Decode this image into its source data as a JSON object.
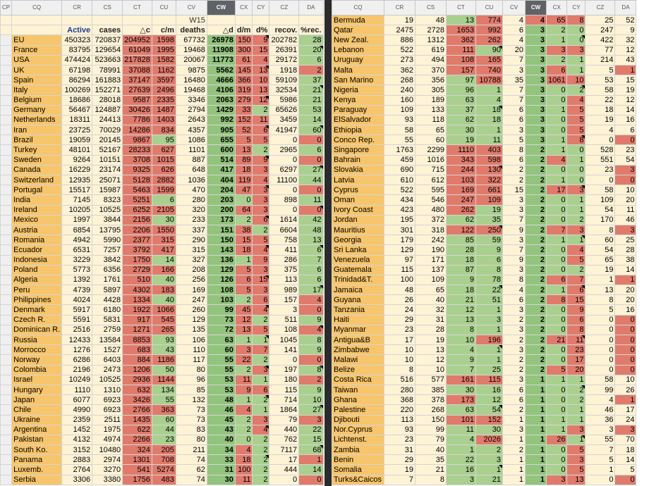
{
  "left": {
    "col_letters": [
      "CP",
      "CQ",
      "CR",
      "CS",
      "CT",
      "CU",
      "CV",
      "CW",
      "CX",
      "CY",
      "CZ",
      "DA"
    ],
    "header_top": [
      "",
      "",
      "",
      "",
      "",
      "",
      "W15",
      "",
      "",
      "",
      "",
      ""
    ],
    "header_bottom": [
      "",
      "",
      "Active",
      "cases",
      "△c",
      "c/m",
      "deaths",
      "△d",
      "d/m",
      "d%",
      "recov.",
      "%rec."
    ],
    "rows": [
      [
        "EU",
        "450323",
        "720837",
        "204952",
        "1598",
        "67732",
        "26978",
        "150",
        "9",
        "202782",
        "28"
      ],
      [
        "France",
        "83795",
        "129654",
        "61049",
        "1995",
        "19468",
        "11908",
        "300",
        "15",
        "26391",
        "20"
      ],
      [
        "USA",
        "474424",
        "523663",
        "217828",
        "1582",
        "20067",
        "11773",
        "61",
        "4",
        "29172",
        "6"
      ],
      [
        "UK",
        "67198",
        "78991",
        "37088",
        "1162",
        "9875",
        "5562",
        "145",
        "13",
        "1918",
        "2"
      ],
      [
        "Spain",
        "86294",
        "161883",
        "37147",
        "3597",
        "16480",
        "4666",
        "366",
        "10",
        "59109",
        "37"
      ],
      [
        "Italy",
        "100269",
        "152271",
        "27639",
        "2496",
        "19468",
        "4106",
        "319",
        "13",
        "32534",
        "21"
      ],
      [
        "Belgium",
        "18686",
        "28018",
        "9587",
        "2335",
        "3346",
        "2063",
        "279",
        "12",
        "5986",
        "21"
      ],
      [
        "Germany",
        "56467",
        "124887",
        "30426",
        "1487",
        "2794",
        "1429",
        "33",
        "2",
        "65626",
        "53"
      ],
      [
        "Netherlands",
        "18311",
        "24413",
        "7786",
        "1403",
        "2643",
        "992",
        "152",
        "11",
        "3459",
        "14"
      ],
      [
        "Iran",
        "23725",
        "70029",
        "14286",
        "834",
        "4357",
        "905",
        "52",
        "6",
        "41947",
        "60"
      ],
      [
        "Brazil",
        "19059",
        "20145",
        "9867",
        "95",
        "1086",
        "655",
        "5",
        "5",
        "0",
        "0"
      ],
      [
        "Turkey",
        "48101",
        "52167",
        "28233",
        "627",
        "1101",
        "600",
        "13",
        "2",
        "2965",
        "6"
      ],
      [
        "Sweden",
        "9264",
        "10151",
        "3708",
        "1015",
        "887",
        "514",
        "89",
        "9",
        "0",
        "0"
      ],
      [
        "Canada",
        "16229",
        "23174",
        "9325",
        "626",
        "648",
        "417",
        "18",
        "3",
        "6297",
        "27"
      ],
      [
        "Switzerland",
        "12935",
        "25071",
        "5128",
        "2882",
        "1036",
        "404",
        "119",
        "4",
        "11100",
        "44"
      ],
      [
        "Portugal",
        "15517",
        "15987",
        "5463",
        "1599",
        "470",
        "204",
        "47",
        "3",
        "0",
        "0"
      ],
      [
        "India",
        "7145",
        "8323",
        "5251",
        "6",
        "280",
        "203",
        "0",
        "3",
        "898",
        "11"
      ],
      [
        "Ireland",
        "10205",
        "10525",
        "6252",
        "2105",
        "320",
        "200",
        "64",
        "3",
        "0",
        "0"
      ],
      [
        "Mexico",
        "1997",
        "3844",
        "2156",
        "30",
        "233",
        "173",
        "2",
        "6",
        "1614",
        "42"
      ],
      [
        "Austria",
        "6854",
        "13795",
        "2206",
        "1550",
        "337",
        "151",
        "38",
        "2",
        "6604",
        "48"
      ],
      [
        "Romania",
        "4942",
        "5990",
        "2377",
        "315",
        "290",
        "150",
        "15",
        "5",
        "758",
        "13"
      ],
      [
        "Ecuador",
        "6531",
        "7257",
        "3792",
        "417",
        "315",
        "143",
        "18",
        "4",
        "411",
        "6"
      ],
      [
        "Indonesia",
        "3229",
        "3842",
        "1750",
        "14",
        "327",
        "136",
        "1",
        "9",
        "286",
        "7"
      ],
      [
        "Poland",
        "5773",
        "6356",
        "2729",
        "166",
        "208",
        "129",
        "5",
        "3",
        "375",
        "6"
      ],
      [
        "Algeria",
        "1392",
        "1761",
        "510",
        "40",
        "256",
        "126",
        "6",
        "15",
        "113",
        "6"
      ],
      [
        "Peru",
        "4739",
        "5897",
        "4302",
        "183",
        "169",
        "108",
        "5",
        "3",
        "989",
        "17"
      ],
      [
        "Philippines",
        "4024",
        "4428",
        "1334",
        "40",
        "247",
        "103",
        "2",
        "6",
        "157",
        "4"
      ],
      [
        "Denmark",
        "5917",
        "6180",
        "1922",
        "1066",
        "260",
        "99",
        "45",
        "4",
        "3",
        "0"
      ],
      [
        "Czech R.",
        "5591",
        "5831",
        "917",
        "545",
        "129",
        "73",
        "12",
        "2",
        "511",
        "9"
      ],
      [
        "Dominican R.",
        "2516",
        "2759",
        "1271",
        "265",
        "135",
        "72",
        "13",
        "5",
        "108",
        "4"
      ],
      [
        "Russia",
        "12433",
        "13584",
        "8853",
        "93",
        "106",
        "63",
        "1",
        "1",
        "1045",
        "8"
      ],
      [
        "Morrocco",
        "1276",
        "1527",
        "683",
        "43",
        "110",
        "60",
        "3",
        "7",
        "141",
        "9"
      ],
      [
        "Norway",
        "6286",
        "6403",
        "884",
        "1186",
        "117",
        "55",
        "22",
        "2",
        "0",
        "0"
      ],
      [
        "Colombia",
        "2196",
        "2473",
        "1206",
        "50",
        "80",
        "55",
        "2",
        "3",
        "197",
        "8"
      ],
      [
        "Israel",
        "10249",
        "10525",
        "2936",
        "1144",
        "96",
        "53",
        "11",
        "1",
        "180",
        "2"
      ],
      [
        "Hungary",
        "1110",
        "1310",
        "632",
        "134",
        "85",
        "53",
        "9",
        "6",
        "115",
        "9"
      ],
      [
        "Japan",
        "6077",
        "6923",
        "3426",
        "55",
        "132",
        "48",
        "1",
        "2",
        "714",
        "10"
      ],
      [
        "Chile",
        "4990",
        "6923",
        "2766",
        "363",
        "73",
        "46",
        "4",
        "1",
        "1864",
        "27"
      ],
      [
        "Ukraine",
        "2359",
        "2511",
        "1435",
        "60",
        "73",
        "45",
        "2",
        "3",
        "79",
        "3"
      ],
      [
        "Argentina",
        "1452",
        "1975",
        "622",
        "44",
        "83",
        "43",
        "2",
        "4",
        "440",
        "22"
      ],
      [
        "Pakistan",
        "4132",
        "4974",
        "2266",
        "23",
        "80",
        "40",
        "0",
        "2",
        "762",
        "15"
      ],
      [
        "South Ko.",
        "3152",
        "10480",
        "324",
        "205",
        "211",
        "34",
        "4",
        "2",
        "7117",
        "68"
      ],
      [
        "Panama",
        "2883",
        "2974",
        "1301",
        "708",
        "74",
        "33",
        "18",
        "2",
        "17",
        "1"
      ],
      [
        "Luxemb.",
        "2764",
        "3270",
        "541",
        "5274",
        "62",
        "31",
        "100",
        "2",
        "444",
        "14"
      ],
      [
        "Serbia",
        "3306",
        "3380",
        "1756",
        "483",
        "74",
        "30",
        "11",
        "2",
        "0",
        "0"
      ]
    ]
  },
  "right": {
    "col_letters": [
      "CQ",
      "CR",
      "CS",
      "CT",
      "CU",
      "CV",
      "CW",
      "CX",
      "CY",
      "CZ",
      "DA"
    ],
    "rows": [
      [
        "Bermuda",
        "19",
        "48",
        "13",
        "774",
        "4",
        "4",
        "65",
        "8",
        "25",
        "52"
      ],
      [
        "Qatar",
        "2475",
        "2728",
        "1653",
        "992",
        "6",
        "3",
        "2",
        "0",
        "247",
        "9"
      ],
      [
        "New Zeal.",
        "886",
        "1312",
        "362",
        "262",
        "4",
        "3",
        "1",
        "0",
        "422",
        "32"
      ],
      [
        "Lebanon",
        "522",
        "619",
        "111",
        "90",
        "20",
        "3",
        "3",
        "3",
        "77",
        "12"
      ],
      [
        "Uruguay",
        "273",
        "494",
        "108",
        "165",
        "7",
        "3",
        "2",
        "1",
        "214",
        "43"
      ],
      [
        "Malta",
        "362",
        "370",
        "157",
        "740",
        "3",
        "3",
        "6",
        "1",
        "5",
        "1"
      ],
      [
        "San Marino",
        "268",
        "356",
        "97",
        "10788",
        "35",
        "3",
        "1061",
        "10",
        "53",
        "15"
      ],
      [
        "Nigeria",
        "240",
        "305",
        "96",
        "1",
        "7",
        "3",
        "0",
        "2",
        "58",
        "19"
      ],
      [
        "Kenya",
        "160",
        "189",
        "63",
        "4",
        "7",
        "3",
        "0",
        "4",
        "22",
        "12"
      ],
      [
        "Paraguay",
        "109",
        "133",
        "37",
        "18",
        "6",
        "3",
        "1",
        "5",
        "18",
        "14"
      ],
      [
        "ElSalvador",
        "93",
        "118",
        "62",
        "18",
        "6",
        "3",
        "0",
        "5",
        "19",
        "16"
      ],
      [
        "Ethiopia",
        "58",
        "65",
        "30",
        "1",
        "3",
        "3",
        "0",
        "5",
        "4",
        "6"
      ],
      [
        "Conco Rep.",
        "55",
        "60",
        "19",
        "11",
        "5",
        "3",
        "1",
        "8",
        "0",
        "0"
      ],
      [
        "Singapore",
        "1763",
        "2299",
        "1110",
        "403",
        "8",
        "2",
        "1",
        "0",
        "528",
        "23"
      ],
      [
        "Bahrain",
        "459",
        "1016",
        "343",
        "598",
        "6",
        "2",
        "4",
        "1",
        "551",
        "54"
      ],
      [
        "Slovakia",
        "690",
        "715",
        "244",
        "130",
        "2",
        "2",
        "0",
        "0",
        "23",
        "3"
      ],
      [
        "Latvia",
        "610",
        "612",
        "103",
        "322",
        "2",
        "2",
        "1",
        "0",
        "0",
        "0"
      ],
      [
        "Cyprus",
        "522",
        "595",
        "169",
        "661",
        "15",
        "2",
        "17",
        "3",
        "58",
        "10"
      ],
      [
        "Oman",
        "434",
        "546",
        "247",
        "109",
        "3",
        "2",
        "0",
        "1",
        "109",
        "20"
      ],
      [
        "Ivory Coast",
        "423",
        "480",
        "262",
        "19",
        "3",
        "2",
        "0",
        "1",
        "54",
        "11"
      ],
      [
        "Jordan",
        "195",
        "372",
        "62",
        "35",
        "7",
        "2",
        "0",
        "2",
        "170",
        "46"
      ],
      [
        "Mauritius",
        "301",
        "318",
        "122",
        "250",
        "9",
        "2",
        "7",
        "3",
        "8",
        "3"
      ],
      [
        "Georgia",
        "179",
        "242",
        "85",
        "59",
        "3",
        "2",
        "1",
        "1",
        "60",
        "25"
      ],
      [
        "Sri Lanka",
        "129",
        "190",
        "28",
        "9",
        "7",
        "2",
        "0",
        "4",
        "54",
        "28"
      ],
      [
        "Venezuela",
        "97",
        "171",
        "18",
        "6",
        "9",
        "2",
        "0",
        "5",
        "65",
        "38"
      ],
      [
        "Guatemala",
        "115",
        "137",
        "87",
        "8",
        "3",
        "2",
        "0",
        "2",
        "19",
        "14"
      ],
      [
        "Trinidad&T.",
        "100",
        "109",
        "9",
        "78",
        "8",
        "2",
        "6",
        "7",
        "1",
        "1"
      ],
      [
        "Jamaica",
        "48",
        "65",
        "18",
        "22",
        "4",
        "2",
        "1",
        "6",
        "13",
        "20"
      ],
      [
        "Guyana",
        "26",
        "40",
        "21",
        "51",
        "6",
        "2",
        "8",
        "15",
        "8",
        "20"
      ],
      [
        "Tanzania",
        "24",
        "32",
        "12",
        "1",
        "3",
        "2",
        "0",
        "9",
        "5",
        "16"
      ],
      [
        "Haiti",
        "29",
        "31",
        "13",
        "3",
        "2",
        "2",
        "0",
        "6",
        "0",
        "0"
      ],
      [
        "Myanmar",
        "23",
        "28",
        "8",
        "1",
        "3",
        "2",
        "0",
        "8",
        "0",
        "0"
      ],
      [
        "Antigua&B",
        "17",
        "19",
        "10",
        "196",
        "2",
        "2",
        "21",
        "11",
        "0",
        "0"
      ],
      [
        "Zimbabwe",
        "10",
        "13",
        "4",
        "1",
        "3",
        "2",
        "0",
        "23",
        "0",
        "0"
      ],
      [
        "Malawi",
        "10",
        "12",
        "9",
        "1",
        "2",
        "2",
        "0",
        "17",
        "0",
        "0"
      ],
      [
        "Belize",
        "8",
        "10",
        "7",
        "25",
        "2",
        "2",
        "5",
        "20",
        "0",
        "0"
      ],
      [
        "Costa Rica",
        "516",
        "577",
        "161",
        "115",
        "3",
        "1",
        "1",
        "1",
        "58",
        "10"
      ],
      [
        "Taiwan",
        "280",
        "385",
        "30",
        "16",
        "6",
        "1",
        "0",
        "2",
        "99",
        "26"
      ],
      [
        "Ghana",
        "368",
        "378",
        "173",
        "12",
        "6",
        "1",
        "0",
        "2",
        "4",
        "1"
      ],
      [
        "Palestine",
        "220",
        "268",
        "63",
        "54",
        "2",
        "1",
        "0",
        "1",
        "46",
        "17"
      ],
      [
        "Djibouti",
        "113",
        "150",
        "101",
        "152",
        "1",
        "1",
        "1",
        "1",
        "36",
        "24"
      ],
      [
        "Nor.Cyprus",
        "93",
        "99",
        "11",
        "30",
        "3",
        "1",
        "1",
        "3",
        "3",
        "3"
      ],
      [
        "Lichtenst.",
        "23",
        "79",
        "4",
        "2026",
        "1",
        "1",
        "26",
        "1",
        "55",
        "70"
      ],
      [
        "Zambia",
        "31",
        "40",
        "1",
        "2",
        "2",
        "1",
        "0",
        "5",
        "7",
        "18"
      ],
      [
        "Benin",
        "29",
        "35",
        "22",
        "3",
        "1",
        "1",
        "0",
        "3",
        "5",
        "14"
      ],
      [
        "Somalia",
        "19",
        "21",
        "16",
        "1",
        "1",
        "1",
        "0",
        "5",
        "1",
        "5"
      ],
      [
        "Turks&Caicos",
        "7",
        "8",
        "3",
        "21",
        "1",
        "1",
        "3",
        "13",
        "0",
        "0"
      ]
    ]
  },
  "colors": {
    "yellow": "#fff3d6",
    "green": "#a9d08e",
    "red": "#e07b6c",
    "orange": "#f7c56b",
    "selected": "#5f6368"
  }
}
